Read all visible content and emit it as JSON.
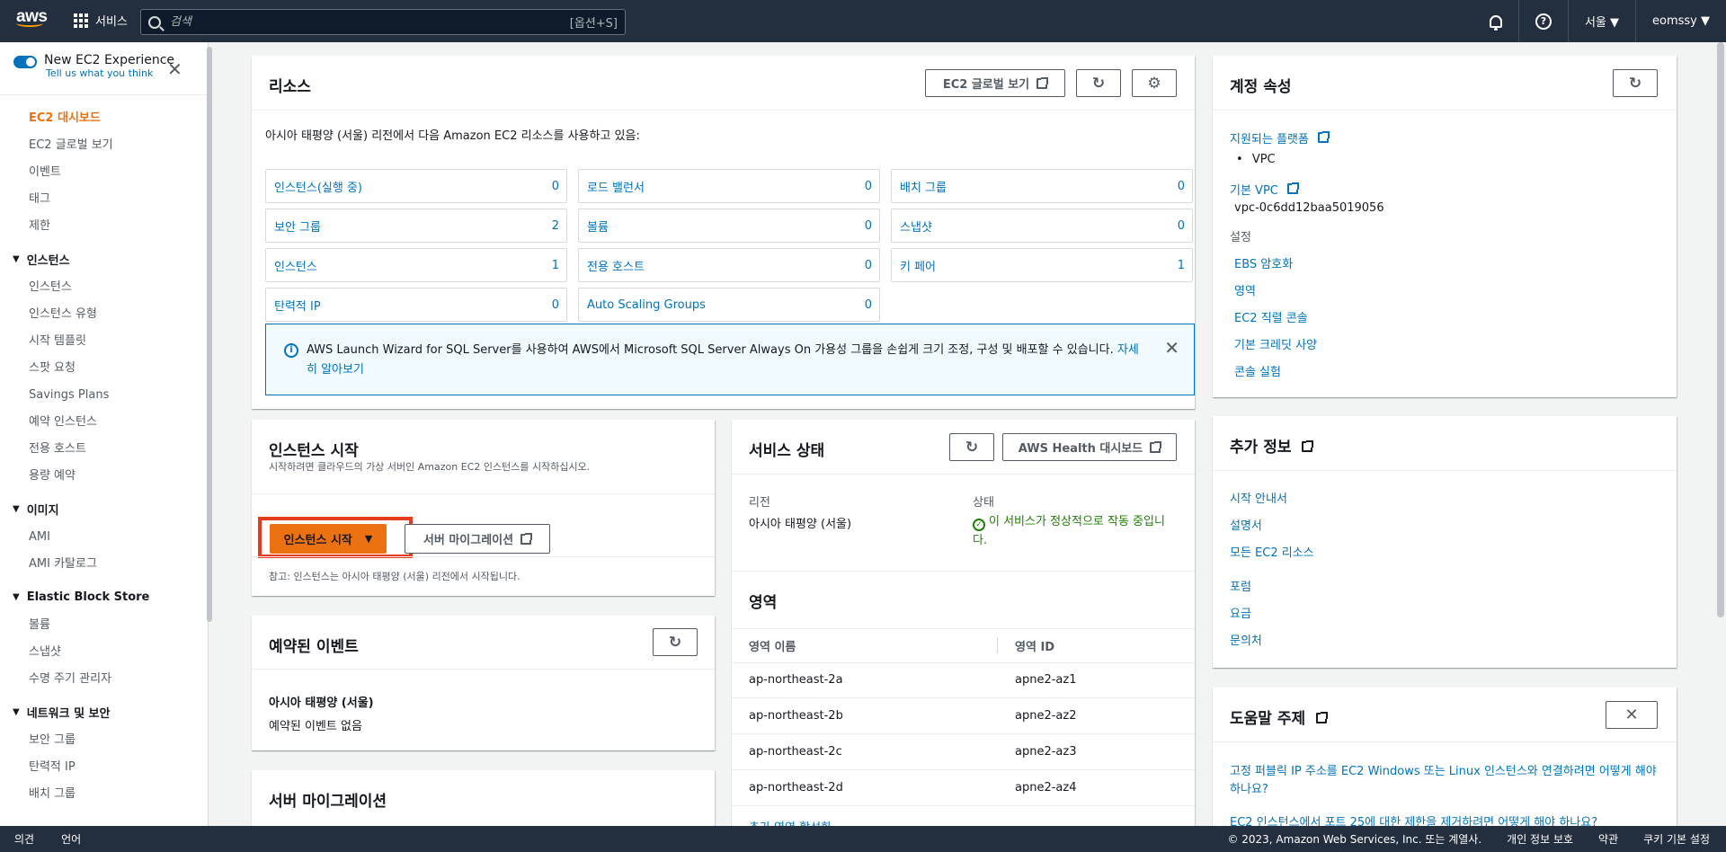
{
  "topnav": {
    "logo_text": "aws",
    "services_label": "서비스",
    "search_placeholder": "검색",
    "search_shortcut": "[옵션+S]",
    "region": "서울 ▼",
    "user": "eomssy ▼"
  },
  "sidebar": {
    "toggle_label": "New EC2 Experience",
    "toggle_sub": "Tell us what you think",
    "top_items": [
      "EC2 대시보드",
      "EC2 글로벌 보기",
      "이벤트",
      "태그",
      "제한"
    ],
    "sections": [
      {
        "title": "인스턴스",
        "items": [
          "인스턴스",
          "인스턴스 유형",
          "시작 템플릿",
          "스팟 요청",
          "Savings Plans",
          "예약 인스턴스",
          "전용 호스트",
          "용량 예약"
        ]
      },
      {
        "title": "이미지",
        "items": [
          "AMI",
          "AMI 카탈로그"
        ]
      },
      {
        "title": "Elastic Block Store",
        "items": [
          "볼륨",
          "스냅샷",
          "수명 주기 관리자"
        ]
      },
      {
        "title": "네트워크 및 보안",
        "items": [
          "보안 그룹",
          "탄력적 IP",
          "배치 그룹"
        ]
      }
    ]
  },
  "resources": {
    "title": "리소스",
    "global_view_label": "EC2 글로벌 보기",
    "intro": "아시아 태평양 (서울) 리전에서 다음 Amazon EC2 리소스를 사용하고 있음:",
    "cells": [
      {
        "label": "인스턴스(실행 중)",
        "count": "0"
      },
      {
        "label": "로드 밸런서",
        "count": "0"
      },
      {
        "label": "배치 그룹",
        "count": "0"
      },
      {
        "label": "보안 그룹",
        "count": "2"
      },
      {
        "label": "볼륨",
        "count": "0"
      },
      {
        "label": "스냅샷",
        "count": "0"
      },
      {
        "label": "인스턴스",
        "count": "1"
      },
      {
        "label": "전용 호스트",
        "count": "0"
      },
      {
        "label": "키 페어",
        "count": "1"
      },
      {
        "label": "탄력적 IP",
        "count": "0"
      },
      {
        "label": "Auto Scaling Groups",
        "count": "0"
      }
    ],
    "info_text": "AWS Launch Wizard for SQL Server를 사용하여 AWS에서 Microsoft SQL Server Always On 가용성 그룹을 손쉽게 크기 조정, 구성 및 배포할 수 있습니다. ",
    "info_link": "자세히 알아보기"
  },
  "launch": {
    "title": "인스턴스 시작",
    "subtitle": "시작하려면 클라우드의 가상 서버인 Amazon EC2 인스턴스를 시작하십시오.",
    "launch_button": "인스턴스 시작",
    "migration_button": "서버 마이그레이션",
    "note": "참고: 인스턴스는 아시아 태평양 (서울) 리전에서 시작됩니다."
  },
  "scheduled": {
    "title": "예약된 이벤트",
    "region": "아시아 태평양 (서울)",
    "empty": "예약된 이벤트 없음"
  },
  "migration_panel": {
    "title": "서버 마이그레이션"
  },
  "service_health": {
    "title": "서비스 상태",
    "health_dashboard": "AWS Health 대시보드",
    "region_label": "리전",
    "region_value": "아시아 태평양 (서울)",
    "status_label": "상태",
    "status_value": "이 서비스가 정상적으로 작동 중입니다."
  },
  "zones": {
    "title": "영역",
    "col_name": "영역 이름",
    "col_id": "영역 ID",
    "rows": [
      {
        "name": "ap-northeast-2a",
        "id": "apne2-az1"
      },
      {
        "name": "ap-northeast-2b",
        "id": "apne2-az2"
      },
      {
        "name": "ap-northeast-2c",
        "id": "apne2-az3"
      },
      {
        "name": "ap-northeast-2d",
        "id": "apne2-az4"
      }
    ],
    "more_link": "추가 영역 활성화"
  },
  "account": {
    "title": "계정 속성",
    "supported_platforms": "지원되는 플랫폼",
    "platform_value": "VPC",
    "default_vpc": "기본 VPC",
    "vpc_id": "vpc-0c6dd12baa5019056",
    "settings_label": "설정",
    "settings_links": [
      "EBS 암호화",
      "영역",
      "EC2 직렬 콘솔",
      "기본 크레딧 사양",
      "콘솔 실험"
    ]
  },
  "more_info": {
    "title": "추가 정보",
    "links_a": [
      "시작 안내서",
      "설명서",
      "모든 EC2 리소스"
    ],
    "links_b": [
      "포럼",
      "요금",
      "문의처"
    ]
  },
  "help_topics": {
    "title": "도움말 주제",
    "link1": "고정 퍼블릭 IP 주소를 EC2 Windows 또는 Linux 인스턴스와 연결하려면 어떻게 해야 하나요?",
    "link2": "EC2 인스턴스에서 포트 25에 대한 제한을 제거하려면 어떻게 해야 하나요?"
  },
  "footer": {
    "feedback": "의견",
    "language": "언어",
    "copyright": "© 2023, Amazon Web Services, Inc. 또는 계열사.",
    "privacy": "개인 정보 보호",
    "terms": "약관",
    "cookies": "쿠키 기본 설정"
  },
  "colors": {
    "accent": "#ec7211",
    "link": "#0073bb",
    "nav": "#232f3e",
    "highlight": "#e53b1f",
    "success": "#1d8102"
  }
}
